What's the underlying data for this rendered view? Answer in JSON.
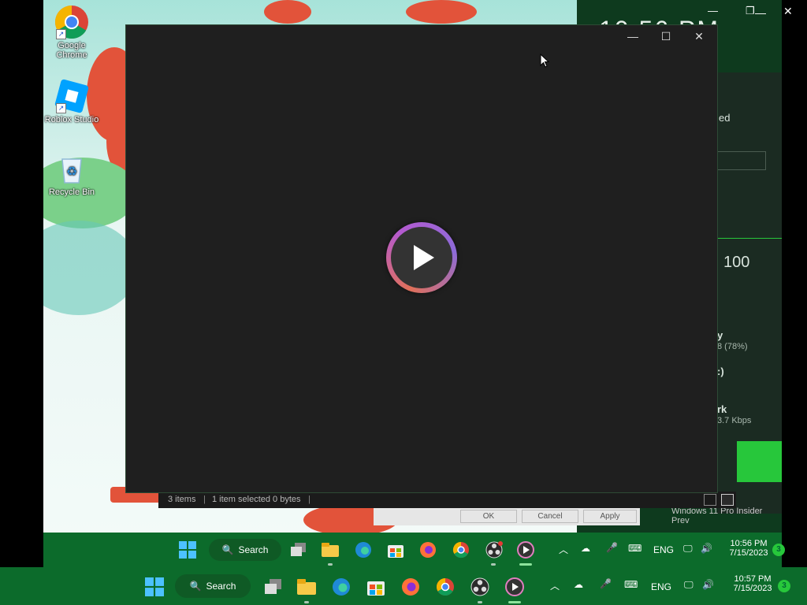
{
  "desktop": {
    "icons": [
      {
        "label": "Google Chrome"
      },
      {
        "label": "Roblox Studio"
      },
      {
        "label": "Recycle Bin"
      }
    ]
  },
  "behind": {
    "clock_fragment": "10:56 PM",
    "panel_text_1": "ed",
    "panel_percent": "100",
    "memory_label": "y",
    "memory_detail": "8 (78%)",
    "disk_label": ":)",
    "network_label": "rk",
    "network_detail": "3.7 Kbps"
  },
  "player": {
    "window_buttons": {
      "minimize": "—",
      "maximize": "☐",
      "close": "✕"
    },
    "play_icon": "play-icon"
  },
  "status_bar": {
    "items_count": "3 items",
    "selection": "1 item selected  0 bytes"
  },
  "dialog": {
    "ok": "OK",
    "cancel": "Cancel",
    "apply": "Apply"
  },
  "watermark": "Windows 11 Pro Insider Prev",
  "inner_taskbar": {
    "search_label": "Search",
    "language": "ENG",
    "time": "10:56 PM",
    "date": "7/15/2023",
    "badge": "3"
  },
  "outer_taskbar": {
    "search_label": "Search",
    "language": "ENG",
    "time": "10:57 PM",
    "date": "7/15/2023",
    "badge": "3"
  },
  "colors": {
    "taskbar": "#0c6b2b",
    "window_bg": "#1f1f1f",
    "accent_green": "#27c73b"
  }
}
